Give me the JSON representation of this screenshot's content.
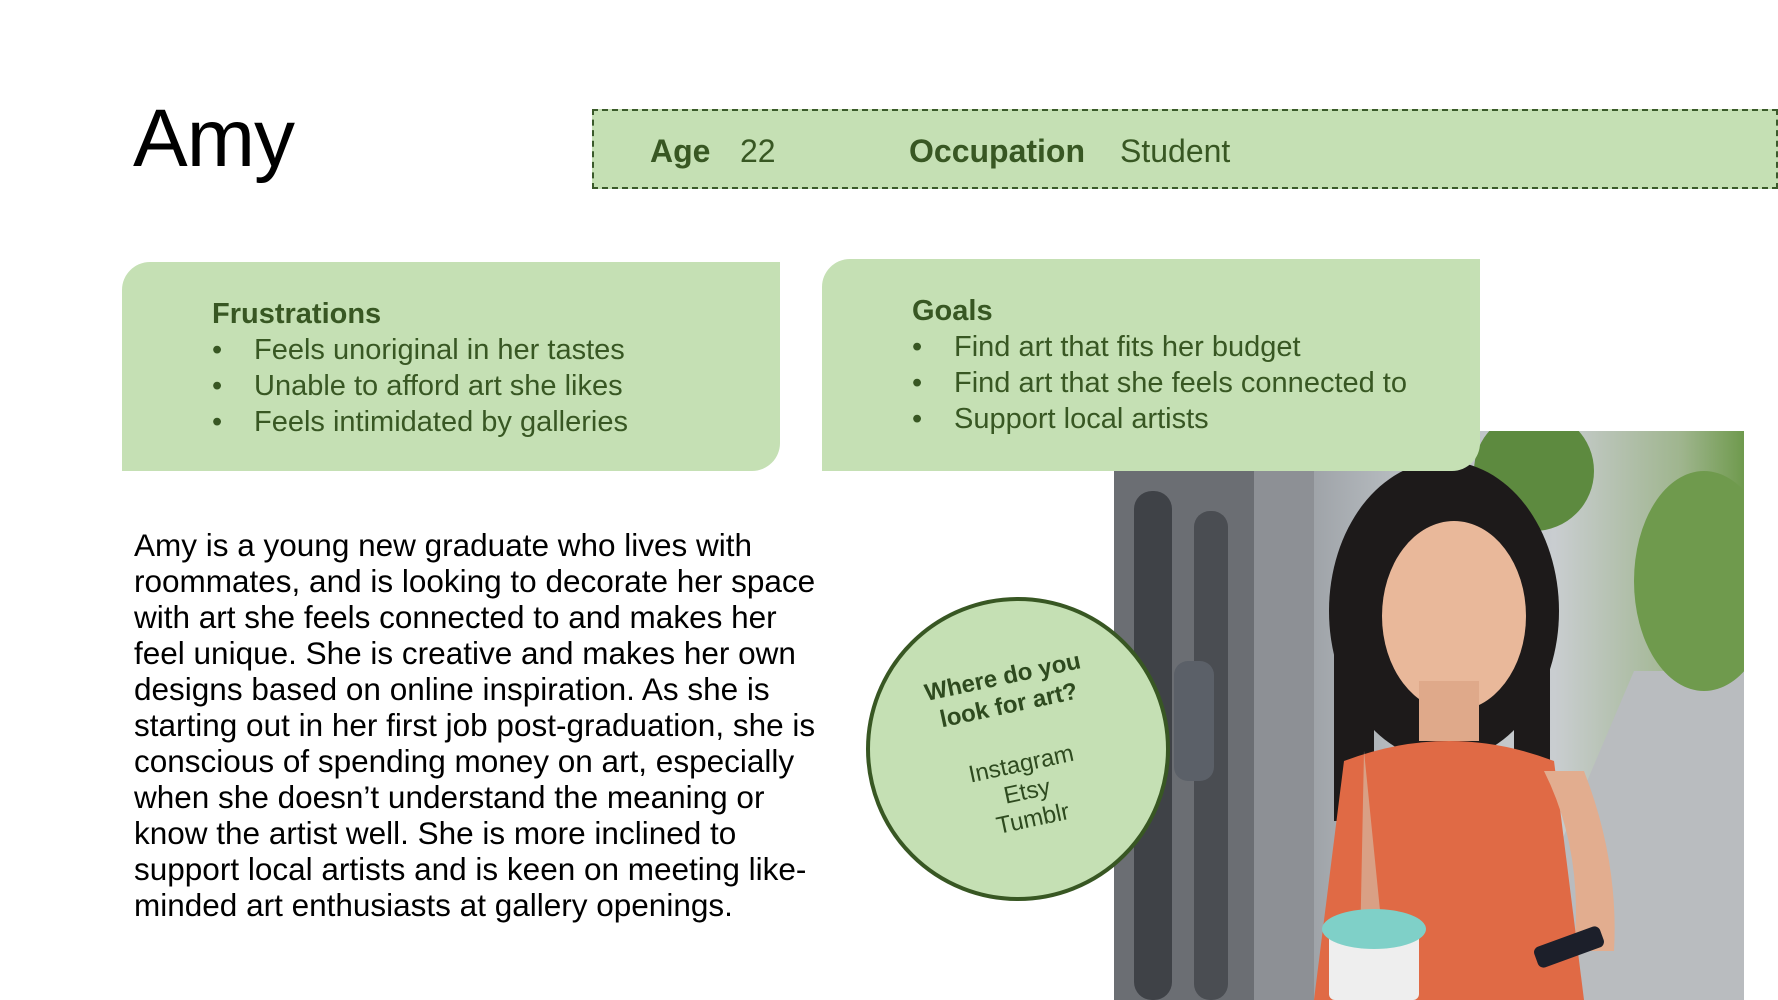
{
  "persona": {
    "name": "Amy",
    "age_label": "Age",
    "age_value": "22",
    "occupation_label": "Occupation",
    "occupation_value": "Student"
  },
  "frustrations": {
    "title": "Frustrations",
    "items": [
      "Feels unoriginal in her tastes",
      "Unable to afford art she likes",
      "Feels intimidated by galleries"
    ]
  },
  "goals": {
    "title": "Goals",
    "items": [
      "Find art that fits her budget",
      "Find art that she feels connected to",
      "Support local artists"
    ]
  },
  "bio": {
    "lines": [
      "Amy is a young new graduate who lives with",
      "roommates, and is looking to decorate her space",
      "with art she feels connected to and makes her",
      "feel unique. She is creative and makes her own",
      "designs based on online inspiration. As she is",
      "starting out in her first job post-graduation, she is",
      "conscious of spending money on art, especially",
      "when she doesn’t understand the meaning or",
      "know the artist well. She is more inclined to",
      "support local artists and is keen on meeting like-",
      "minded art enthusiasts at gallery openings."
    ]
  },
  "bubble": {
    "question_line1": "Where do you",
    "question_line2": "look for art?",
    "sources": [
      "Instagram",
      "Etsy",
      "Tumblr"
    ]
  },
  "bullet_glyph": "•",
  "colors": {
    "card_fill": "#c5e0b4",
    "card_text": "#385723"
  }
}
